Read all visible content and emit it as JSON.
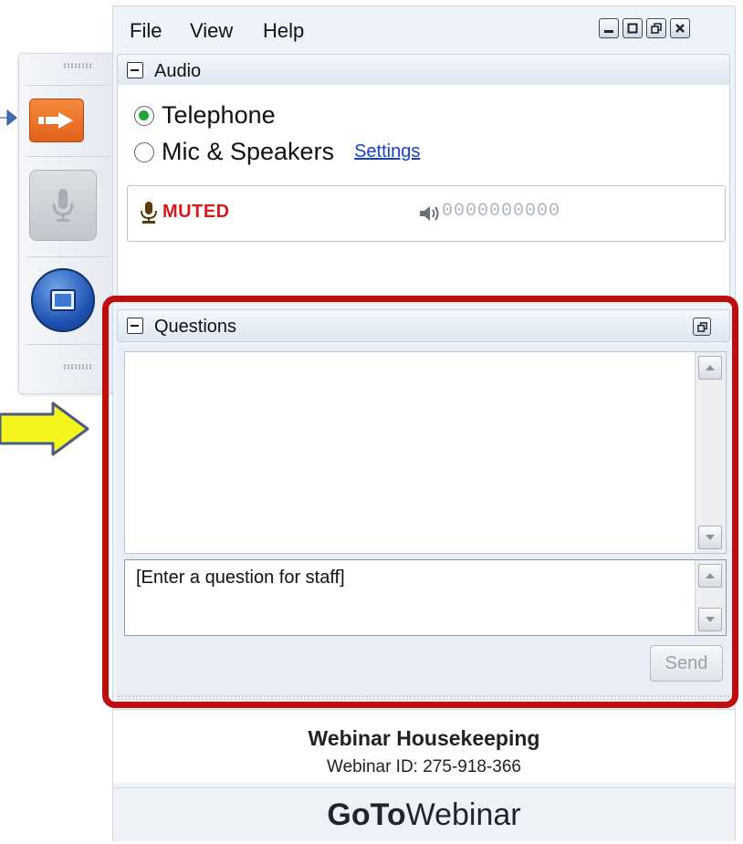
{
  "menu": {
    "file": "File",
    "view": "View",
    "help": "Help"
  },
  "window_controls": {
    "minimize_icon": "minimize-icon",
    "maximize_icon": "maximize-icon",
    "restore_icon": "restore-icon",
    "close_icon": "close-icon"
  },
  "audio": {
    "title": "Audio",
    "options": [
      {
        "label": "Telephone",
        "selected": true
      },
      {
        "label": "Mic & Speakers",
        "selected": false
      }
    ],
    "settings_link": "Settings",
    "status": "MUTED",
    "level_meter": "0000000000"
  },
  "questions": {
    "title": "Questions",
    "placeholder": "[Enter a question for staff]",
    "send_label": "Send"
  },
  "footer": {
    "title": "Webinar Housekeeping",
    "webinar_id": "Webinar ID: 275-918-366"
  },
  "brand": {
    "bold": "GoTo",
    "regular": "Webinar"
  },
  "colors": {
    "highlight_outline": "#c00d0d",
    "muted_red": "#d81a1a",
    "link_blue": "#1a3fcc",
    "yellow_arrow": "#f5f51e",
    "tool_orange": "#e0611a"
  }
}
